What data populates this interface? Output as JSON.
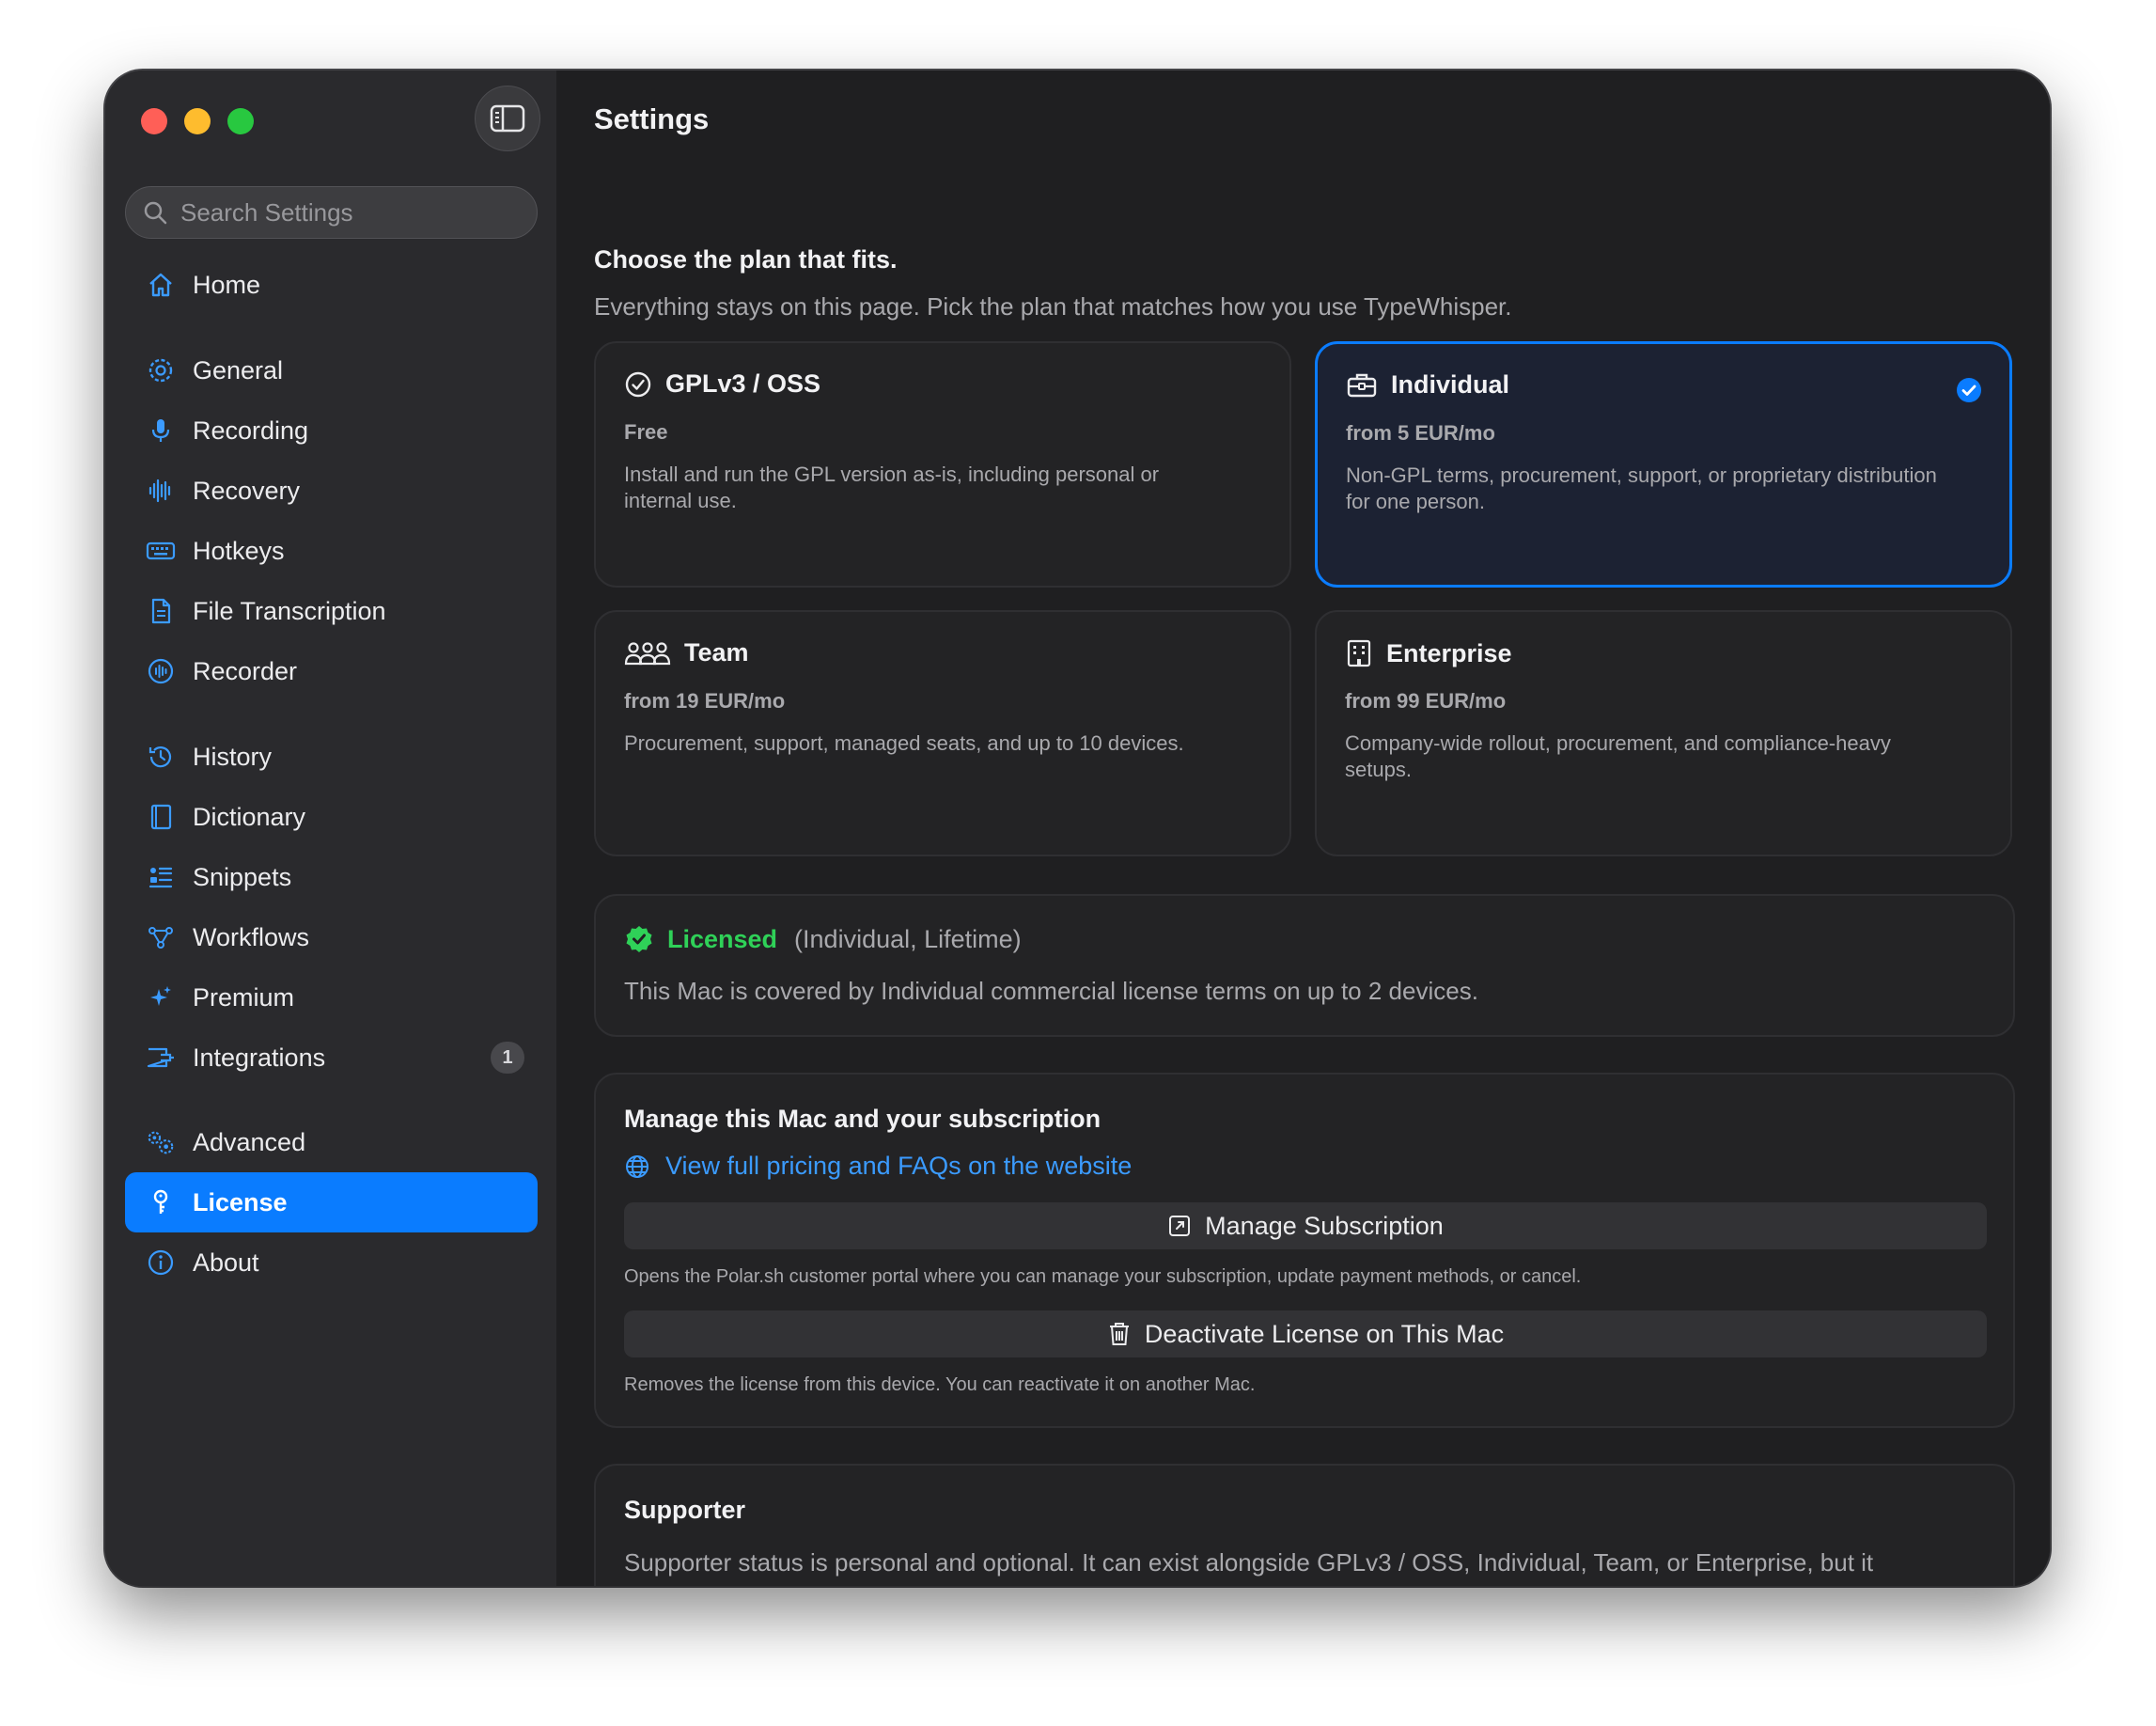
{
  "window": {
    "title": "Settings"
  },
  "sidebar": {
    "search_placeholder": "Search Settings",
    "items": [
      {
        "label": "Home",
        "icon": "house-icon"
      },
      {
        "label": "General",
        "icon": "gear-icon"
      },
      {
        "label": "Recording",
        "icon": "microphone-icon"
      },
      {
        "label": "Recovery",
        "icon": "waveform-icon"
      },
      {
        "label": "Hotkeys",
        "icon": "keyboard-icon"
      },
      {
        "label": "File Transcription",
        "icon": "document-icon"
      },
      {
        "label": "Recorder",
        "icon": "record-icon"
      },
      {
        "label": "History",
        "icon": "clock-history-icon"
      },
      {
        "label": "Dictionary",
        "icon": "book-icon"
      },
      {
        "label": "Snippets",
        "icon": "snippets-icon"
      },
      {
        "label": "Workflows",
        "icon": "workflow-icon"
      },
      {
        "label": "Premium",
        "icon": "sparkles-icon"
      },
      {
        "label": "Integrations",
        "icon": "plug-icon",
        "badge": "1"
      },
      {
        "label": "Advanced",
        "icon": "gears-icon"
      },
      {
        "label": "License",
        "icon": "key-icon",
        "selected": true
      },
      {
        "label": "About",
        "icon": "info-icon"
      }
    ]
  },
  "plans": {
    "heading": "Choose the plan that fits.",
    "subheading": "Everything stays on this page. Pick the plan that matches how you use TypeWhisper.",
    "cards": [
      {
        "name": "GPLv3 / OSS",
        "price": "Free",
        "desc": "Install and run the GPL version as-is, including personal or internal use.",
        "icon": "checkmark-circle-icon",
        "selected": false
      },
      {
        "name": "Individual",
        "price": "from 5 EUR/mo",
        "desc": "Non-GPL terms, procurement, support, or proprietary distribution for one person.",
        "icon": "briefcase-icon",
        "selected": true
      },
      {
        "name": "Team",
        "price": "from 19 EUR/mo",
        "desc": "Procurement, support, managed seats, and up to 10 devices.",
        "icon": "people-icon",
        "selected": false
      },
      {
        "name": "Enterprise",
        "price": "from 99 EUR/mo",
        "desc": "Company-wide rollout, procurement, and compliance-heavy setups.",
        "icon": "building-icon",
        "selected": false
      }
    ]
  },
  "license": {
    "status": "Licensed",
    "detail": "(Individual, Lifetime)",
    "description": "This Mac is covered by Individual commercial license terms on up to 2 devices."
  },
  "manage": {
    "title": "Manage this Mac and your subscription",
    "link": "View full pricing and FAQs on the website",
    "manage_button": "Manage Subscription",
    "manage_help": "Opens the Polar.sh customer portal where you can manage your subscription, update payment methods, or cancel.",
    "deactivate_button": "Deactivate License on This Mac",
    "deactivate_help": "Removes the license from this device. You can reactivate it on another Mac."
  },
  "supporter": {
    "title": "Supporter",
    "description": "Supporter status is personal and optional. It can exist alongside GPLv3 / OSS, Individual, Team, or Enterprise, but it"
  },
  "colors": {
    "accent": "#0a7cff",
    "success": "#2fd158",
    "link": "#3b9bff"
  }
}
